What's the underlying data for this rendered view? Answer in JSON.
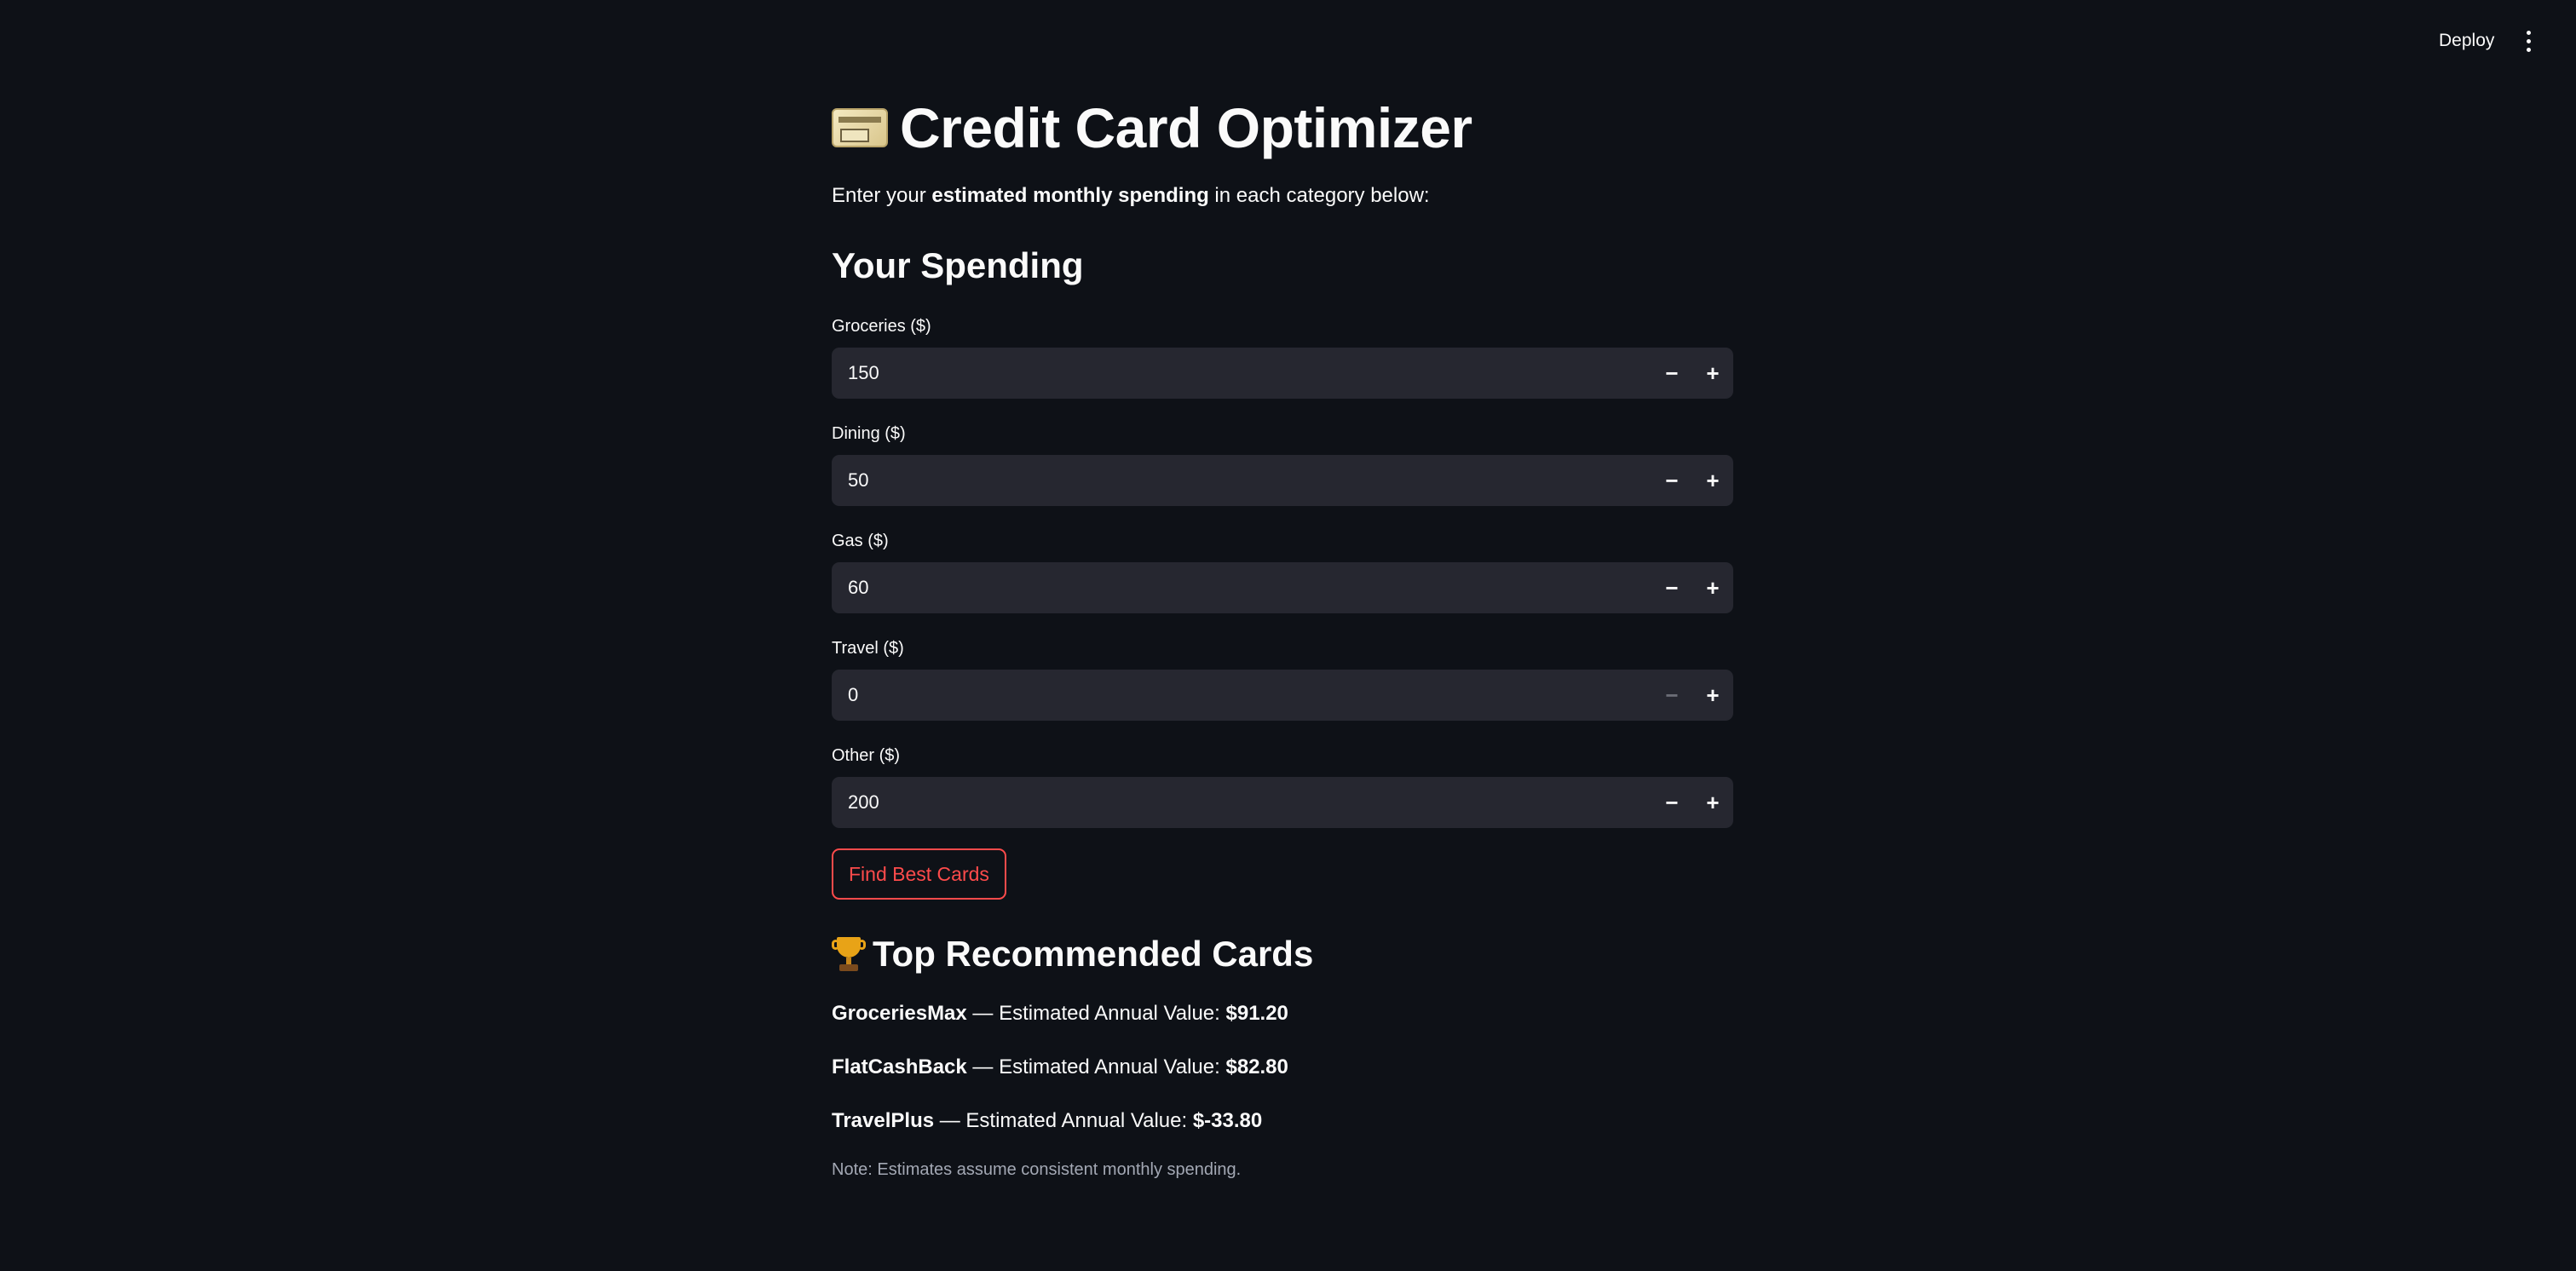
{
  "header": {
    "deploy_label": "Deploy",
    "menu_icon": "more-vertical-icon"
  },
  "page": {
    "title_icon": "credit-card-icon",
    "title": "Credit Card Optimizer",
    "intro_prefix": "Enter your ",
    "intro_bold": "estimated monthly spending",
    "intro_suffix": " in each category below:"
  },
  "spending": {
    "heading": "Your Spending",
    "fields": [
      {
        "label": "Groceries ($)",
        "value": "150",
        "minus_disabled": false
      },
      {
        "label": "Dining ($)",
        "value": "50",
        "minus_disabled": false
      },
      {
        "label": "Gas ($)",
        "value": "60",
        "minus_disabled": false
      },
      {
        "label": "Travel ($)",
        "value": "0",
        "minus_disabled": true
      },
      {
        "label": "Other ($)",
        "value": "200",
        "minus_disabled": false
      }
    ],
    "minus_symbol": "−",
    "plus_symbol": "+"
  },
  "action": {
    "find_label": "Find Best Cards"
  },
  "results": {
    "heading_icon": "trophy-icon",
    "heading": "Top Recommended Cards",
    "value_label": " — Estimated Annual Value: ",
    "cards": [
      {
        "name": "GroceriesMax",
        "value": "$91.20"
      },
      {
        "name": "FlatCashBack",
        "value": "$82.80"
      },
      {
        "name": "TravelPlus",
        "value": "$-33.80"
      }
    ],
    "note": "Note: Estimates assume consistent monthly spending."
  },
  "colors": {
    "background": "#0e1117",
    "input_background": "#262730",
    "accent": "#ff4b4b",
    "text": "#fafafa",
    "muted_text": "#a3a8b4"
  }
}
